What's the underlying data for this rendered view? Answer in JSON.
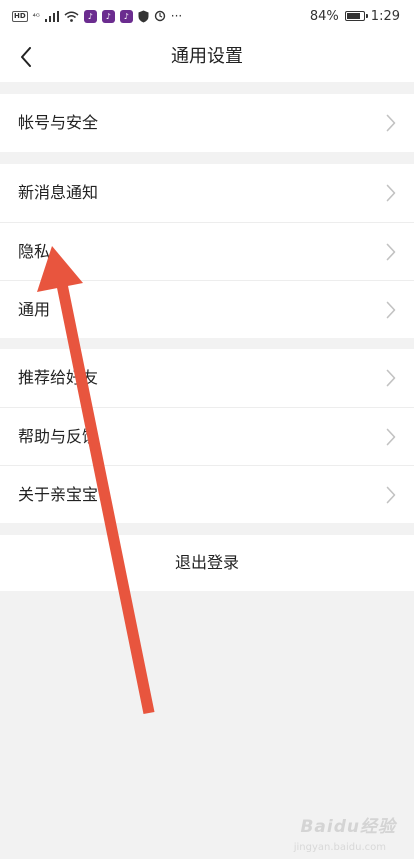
{
  "status_bar": {
    "hd": "HD",
    "signal": "⁴ᴳ",
    "battery_text": "84%",
    "battery_level": 0.84,
    "time": "1:29",
    "more": "···"
  },
  "nav": {
    "title": "通用设置"
  },
  "groups": [
    {
      "items": [
        {
          "label": "帐号与安全"
        }
      ]
    },
    {
      "items": [
        {
          "label": "新消息通知"
        },
        {
          "label": "隐私"
        },
        {
          "label": "通用"
        }
      ]
    },
    {
      "items": [
        {
          "label": "推荐给好友"
        },
        {
          "label": "帮助与反馈"
        },
        {
          "label": "关于亲宝宝"
        }
      ]
    }
  ],
  "logout": {
    "label": "退出登录"
  },
  "watermark": {
    "text": "Baidu经验",
    "sub": "jingyan.baidu.com"
  },
  "colors": {
    "annotation_arrow": "#e8553e",
    "background": "#f2f2f2",
    "chevron": "#c2c2c2"
  }
}
